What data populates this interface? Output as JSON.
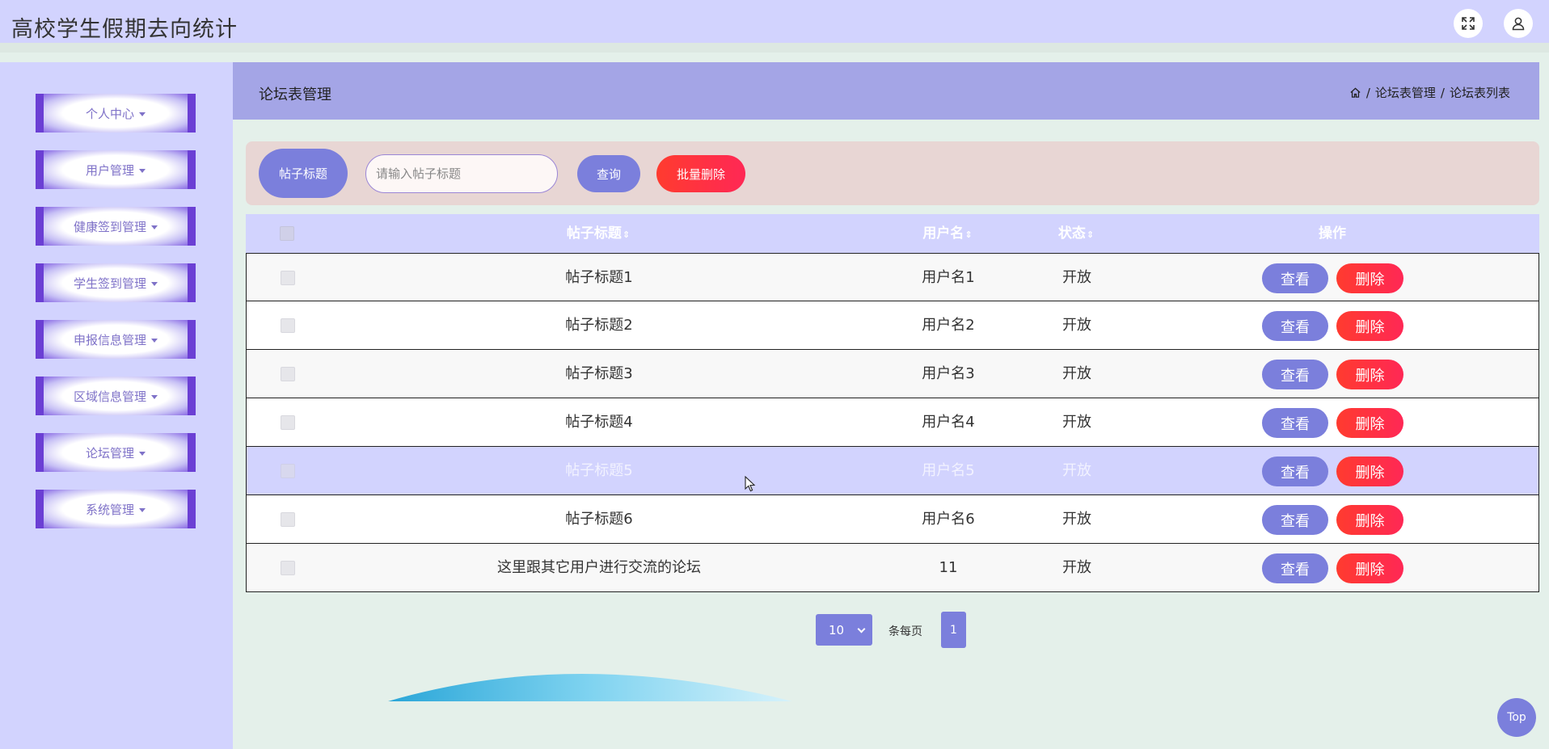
{
  "app": {
    "title": "高校学生假期去向统计"
  },
  "header_icons": [
    "fullscreen-icon",
    "user-icon"
  ],
  "sidebar": {
    "items": [
      {
        "label": "个人中心"
      },
      {
        "label": "用户管理"
      },
      {
        "label": "健康签到管理"
      },
      {
        "label": "学生签到管理"
      },
      {
        "label": "申报信息管理"
      },
      {
        "label": "区域信息管理"
      },
      {
        "label": "论坛管理"
      },
      {
        "label": "系统管理"
      }
    ]
  },
  "main": {
    "title": "论坛表管理",
    "breadcrumb": [
      "论坛表管理",
      "论坛表列表"
    ]
  },
  "search": {
    "label": "帖子标题",
    "placeholder": "请输入帖子标题",
    "query_label": "查询",
    "batch_delete_label": "批量删除"
  },
  "table": {
    "columns": [
      "帖子标题",
      "用户名",
      "状态",
      "操作"
    ],
    "sort_glyph": "⇕",
    "view_label": "查看",
    "delete_label": "删除",
    "rows": [
      {
        "title": "帖子标题1",
        "username": "用户名1",
        "status": "开放"
      },
      {
        "title": "帖子标题2",
        "username": "用户名2",
        "status": "开放"
      },
      {
        "title": "帖子标题3",
        "username": "用户名3",
        "status": "开放"
      },
      {
        "title": "帖子标题4",
        "username": "用户名4",
        "status": "开放"
      },
      {
        "title": "帖子标题5",
        "username": "用户名5",
        "status": "开放"
      },
      {
        "title": "帖子标题6",
        "username": "用户名6",
        "status": "开放"
      },
      {
        "title": "这里跟其它用户进行交流的论坛",
        "username": "11",
        "status": "开放"
      }
    ]
  },
  "pagination": {
    "page_size": "10",
    "per_page_label": "条每页",
    "current_page": "1"
  },
  "back_to_top_label": "Top",
  "colors": {
    "accent": "#7b7fdc",
    "danger": "#ff2d45",
    "header_bg": "#d2d3fe",
    "subheader_bg": "#a4a5e6",
    "page_bg": "#e4f0ea"
  }
}
